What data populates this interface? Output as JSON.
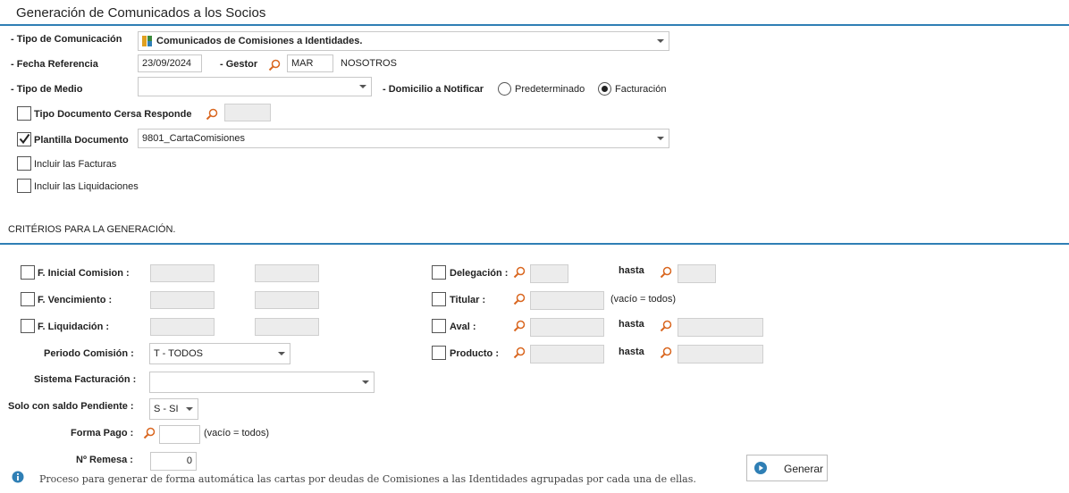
{
  "page": {
    "title": "Generación de Comunicados a los Socios",
    "section_criteria": "CRITÉRIOS PARA LA GENERACIÓN.",
    "footer_note": "Proceso para generar de forma automática las cartas por deudas de Comisiones a las Identidades agrupadas por cada una de ellas.",
    "accent_color": "#2f7fb5",
    "search_icon_color": "#d9661f"
  },
  "form": {
    "tipo_comunicacion": {
      "label": "- Tipo de Comunicación",
      "value": "Comunicados de Comisiones a Identidades."
    },
    "fecha_referencia": {
      "label": "- Fecha Referencia",
      "value": "23/09/2024"
    },
    "gestor": {
      "label": "- Gestor",
      "code": "MAR",
      "name": "NOSOTROS"
    },
    "tipo_medio": {
      "label": "- Tipo de Medio",
      "value": ""
    },
    "domicilio": {
      "label": "- Domicilio a Notificar",
      "options": [
        "Predeterminado",
        "Facturación"
      ],
      "selected": "Facturación"
    },
    "tipo_documento": {
      "label": "Tipo Documento Cersa Responde",
      "checked": false,
      "value": ""
    },
    "plantilla": {
      "label": "Plantilla Documento",
      "checked": true,
      "value": "9801_CartaComisiones"
    },
    "incluir_facturas": {
      "label": "Incluir las Facturas",
      "checked": false
    },
    "incluir_liquidaciones": {
      "label": "Incluir las Liquidaciones",
      "checked": false
    }
  },
  "criteria": {
    "f_inicial": {
      "label": "F. Inicial Comision :",
      "checked": false
    },
    "f_vencimiento": {
      "label": "F. Vencimiento :",
      "checked": false
    },
    "f_liquidacion": {
      "label": "F. Liquidación :",
      "checked": false
    },
    "periodo": {
      "label": "Periodo Comisión :",
      "value": "T - TODOS"
    },
    "sistema": {
      "label": "Sistema Facturación :",
      "value": ""
    },
    "saldo": {
      "label": "Solo con saldo Pendiente :",
      "value": "S - SI"
    },
    "forma_pago": {
      "label": "Forma Pago :",
      "hint": "(vacío = todos)"
    },
    "remesa": {
      "label": "Nº Remesa :",
      "value": "0"
    },
    "delegacion": {
      "label": "Delegación :",
      "hasta": "hasta",
      "checked": false
    },
    "titular": {
      "label": "Titular :",
      "hint": "(vacío = todos)",
      "checked": false
    },
    "aval": {
      "label": "Aval :",
      "hasta": "hasta",
      "checked": false
    },
    "producto": {
      "label": "Producto :",
      "hasta": "hasta",
      "checked": false
    }
  },
  "actions": {
    "generar_label": "Generar"
  }
}
